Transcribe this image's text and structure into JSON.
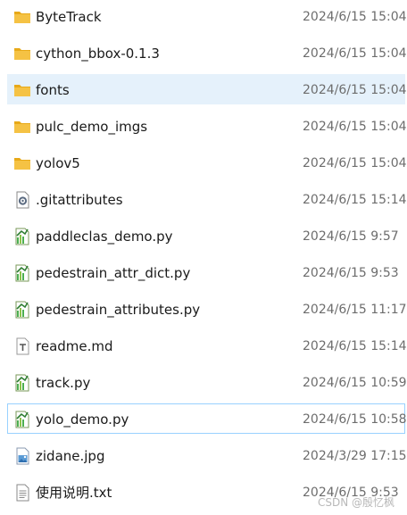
{
  "files": [
    {
      "name": "ByteTrack",
      "date": "2024/6/15 15:04",
      "icon": "folder-icon"
    },
    {
      "name": "cython_bbox-0.1.3",
      "date": "2024/6/15 15:04",
      "icon": "folder-icon"
    },
    {
      "name": "fonts",
      "date": "2024/6/15 15:04",
      "icon": "folder-icon"
    },
    {
      "name": "pulc_demo_imgs",
      "date": "2024/6/15 15:04",
      "icon": "folder-icon"
    },
    {
      "name": "yolov5",
      "date": "2024/6/15 15:04",
      "icon": "folder-icon"
    },
    {
      "name": ".gitattributes",
      "date": "2024/6/15 15:14",
      "icon": "settings-file-icon"
    },
    {
      "name": "paddleclas_demo.py",
      "date": "2024/6/15 9:57",
      "icon": "python-file-icon"
    },
    {
      "name": "pedestrain_attr_dict.py",
      "date": "2024/6/15 9:53",
      "icon": "python-file-icon"
    },
    {
      "name": "pedestrain_attributes.py",
      "date": "2024/6/15 11:17",
      "icon": "python-file-icon"
    },
    {
      "name": "readme.md",
      "date": "2024/6/15 15:14",
      "icon": "text-file-icon"
    },
    {
      "name": "track.py",
      "date": "2024/6/15 10:59",
      "icon": "python-file-icon"
    },
    {
      "name": "yolo_demo.py",
      "date": "2024/6/15 10:58",
      "icon": "python-file-icon"
    },
    {
      "name": "zidane.jpg",
      "date": "2024/3/29 17:15",
      "icon": "image-file-icon"
    },
    {
      "name": "使用说明.txt",
      "date": "2024/6/15 9:53",
      "icon": "txt-file-icon"
    }
  ],
  "watermark": "CSDN @殷忆枫",
  "colors": {
    "folder": "#f5c244",
    "selected_bg": "#e5f1fb",
    "focus_border": "#99d1ff",
    "date_text": "#6d6d6d"
  }
}
